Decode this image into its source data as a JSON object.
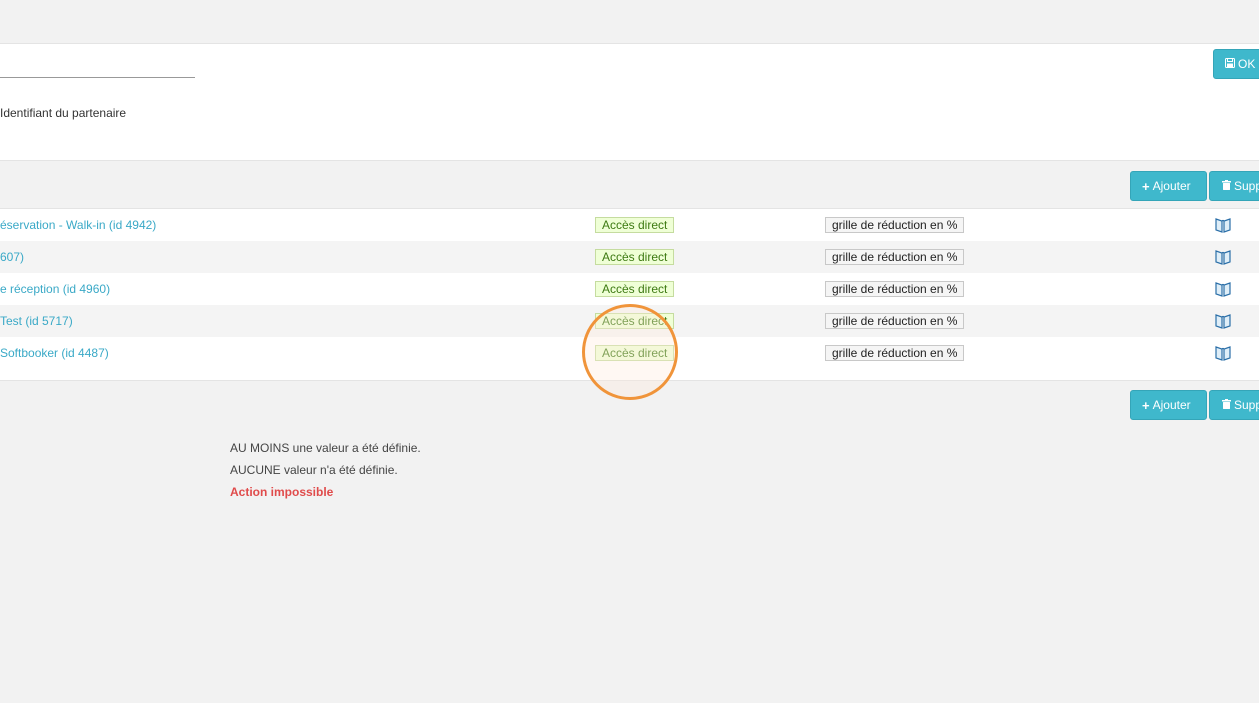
{
  "form": {
    "partner_id_label": "Identifiant du partenaire",
    "ok_label": "OK"
  },
  "actions": {
    "add_label": "Ajouter",
    "delete_label": "Supp"
  },
  "table": {
    "rows": [
      {
        "name": "éservation - Walk-in (id 4942)",
        "access": "Accès direct",
        "grid": "grille de réduction en %",
        "icon": "book-icon"
      },
      {
        "name": "607)",
        "access": "Accès direct",
        "grid": "grille de réduction en %",
        "icon": "book-icon"
      },
      {
        "name": "e réception (id 4960)",
        "access": "Accès direct",
        "grid": "grille de réduction en %",
        "icon": "book-icon"
      },
      {
        "name": "Test (id 5717)",
        "access": "Accès direct",
        "grid": "grille de réduction en %",
        "icon": "book-icon"
      },
      {
        "name": "Softbooker (id 4487)",
        "access": "Accès direct",
        "grid": "grille de réduction en %",
        "icon": "book-icon"
      }
    ]
  },
  "legend": {
    "line1": "AU MOINS une valeur a été définie.",
    "line2": "AUCUNE valeur n'a été définie.",
    "line3": "Action impossible"
  },
  "colors": {
    "accent": "#3fb8cc",
    "link": "#3aa9c7",
    "access_bg": "#efffd6",
    "error": "#e04b4b",
    "highlight": "#f0943a"
  },
  "icons": [
    "save-icon",
    "plus-icon",
    "trash-icon",
    "book-icon"
  ]
}
